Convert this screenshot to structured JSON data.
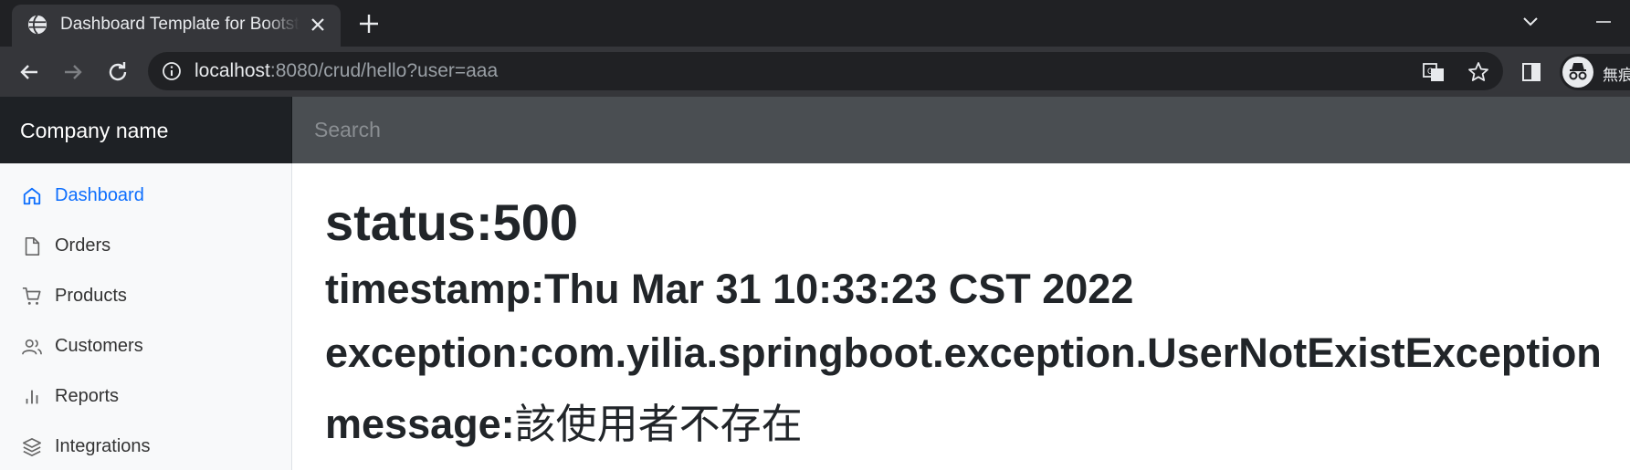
{
  "browser": {
    "tab_title": "Dashboard Template for Bootstrap",
    "url_host": "localhost",
    "url_rest": ":8080/crud/hello?user=aaa",
    "profile_label": "無痕"
  },
  "navbar": {
    "brand": "Company name",
    "search_placeholder": "Search"
  },
  "sidebar": {
    "items": [
      {
        "label": "Dashboard",
        "icon": "home-icon",
        "active": true
      },
      {
        "label": "Orders",
        "icon": "file-icon"
      },
      {
        "label": "Products",
        "icon": "shopping-cart-icon"
      },
      {
        "label": "Customers",
        "icon": "users-icon"
      },
      {
        "label": "Reports",
        "icon": "bar-chart-icon"
      },
      {
        "label": "Integrations",
        "icon": "layers-icon"
      }
    ]
  },
  "error": {
    "status": "status:500",
    "timestamp": "timestamp:Thu Mar 31 10:33:23 CST 2022",
    "exception": "exception:com.yilia.springboot.exception.UserNotExistException",
    "message_label": "message:",
    "message_value": "該使用者不存在"
  },
  "colors": {
    "active_link": "#0d6efd",
    "navbar_bg": "#212529",
    "browser_bg": "#202124"
  }
}
